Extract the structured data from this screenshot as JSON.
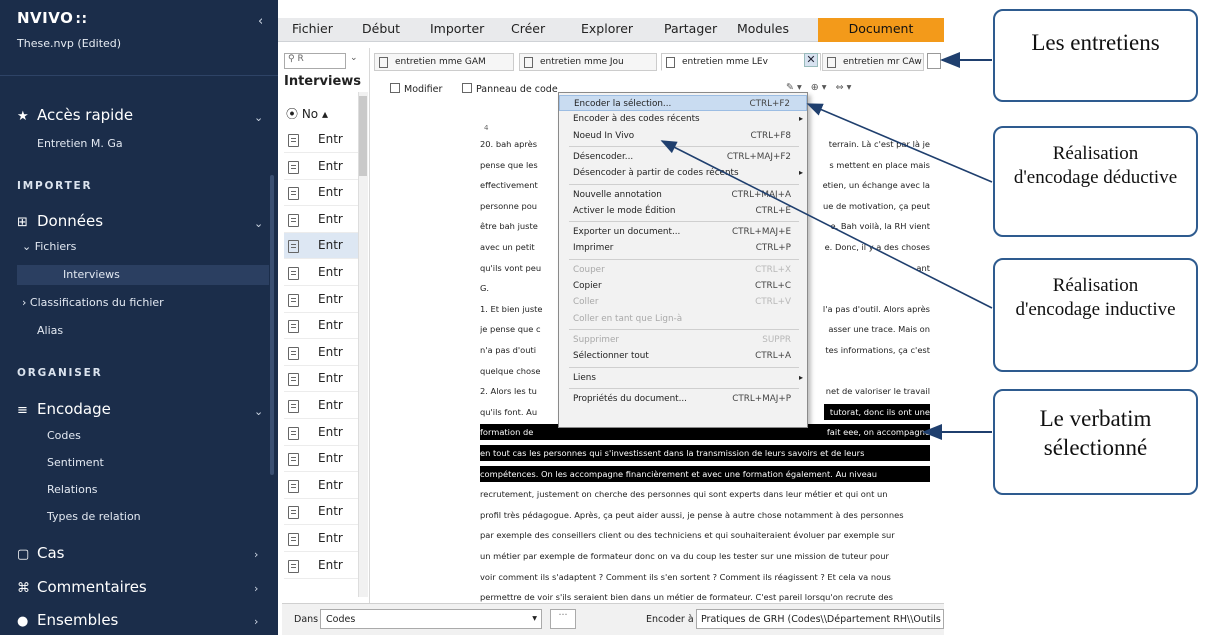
{
  "sidebar": {
    "app_name": "NVIVO",
    "app_dots": "::",
    "project": "These.nvp (Edited)",
    "quick_access": "Accès rapide",
    "quick_item": "Entretien M. Ga",
    "importer": "IMPORTER",
    "donnees": "Données",
    "fichiers": "Fichiers",
    "interviews": "Interviews",
    "classifications": "Classifications du fichier",
    "alias": "Alias",
    "organiser": "ORGANISER",
    "encodage": "Encodage",
    "codes": "Codes",
    "sentiment": "Sentiment",
    "relations": "Relations",
    "types_relation": "Types de relation",
    "cas": "Cas",
    "commentaires": "Commentaires",
    "ensembles": "Ensembles"
  },
  "ribbon": {
    "tabs": [
      "Fichier",
      "Début",
      "Importer",
      "Créer",
      "Explorer",
      "Partager",
      "Modules"
    ],
    "active_tab": "Document"
  },
  "list": {
    "search_placeholder": "R",
    "title": "Interviews",
    "col_header": "No",
    "item_label": "Entr",
    "row_count": 17
  },
  "doc_tabs": [
    "entretien mme GAM",
    "entretien mme Jou",
    "entretien mme LEv",
    "entretien mr CAw"
  ],
  "toolbar": {
    "modifier": "Modifier",
    "panneau": "Panneau de code"
  },
  "context_menu": [
    {
      "label": "Encoder la sélection...",
      "shortcut": "CTRL+F2",
      "state": "hover"
    },
    {
      "label": "Encoder à des codes récents",
      "shortcut": "",
      "submenu": true
    },
    {
      "label": "Noeud In Vivo",
      "shortcut": "CTRL+F8"
    },
    {
      "sep": true
    },
    {
      "label": "Désencoder...",
      "shortcut": "CTRL+MAJ+F2"
    },
    {
      "label": "Désencoder à partir de codes récents",
      "shortcut": "",
      "submenu": true
    },
    {
      "sep": true
    },
    {
      "label": "Nouvelle annotation",
      "shortcut": "CTRL+MAJ+A"
    },
    {
      "label": "Activer le mode Édition",
      "shortcut": "CTRL+E"
    },
    {
      "sep": true
    },
    {
      "label": "Exporter un document...",
      "shortcut": "CTRL+MAJ+E"
    },
    {
      "label": "Imprimer",
      "shortcut": "CTRL+P"
    },
    {
      "sep": true
    },
    {
      "label": "Couper",
      "shortcut": "CTRL+X",
      "disabled": true
    },
    {
      "label": "Copier",
      "shortcut": "CTRL+C"
    },
    {
      "label": "Coller",
      "shortcut": "CTRL+V",
      "disabled": true
    },
    {
      "label": "Coller en tant que Lign-à",
      "shortcut": "",
      "disabled": true
    },
    {
      "sep": true
    },
    {
      "label": "Supprimer",
      "shortcut": "SUPPR",
      "disabled": true
    },
    {
      "label": "Sélectionner tout",
      "shortcut": "CTRL+A"
    },
    {
      "sep": true
    },
    {
      "label": "Liens",
      "shortcut": "",
      "submenu": true
    },
    {
      "sep": true
    },
    {
      "label": "Propriétés du document...",
      "shortcut": "CTRL+MAJ+P"
    }
  ],
  "doc_lines": [
    {
      "l": "20. bah après",
      "r": "terrain. Là c'est par là je"
    },
    {
      "l": "pense que les",
      "r": "s mettent en place mais"
    },
    {
      "l": "effectivement",
      "r": "etien, un échange avec la"
    },
    {
      "l": "personne pou",
      "r": "ue de motivation, ça peut"
    },
    {
      "l": "être bah juste",
      "r": "e. Bah voilà, la RH vient"
    },
    {
      "l": "avec un petit",
      "r": "e. Donc, il y a des choses"
    },
    {
      "l": "qu'ils vont peu",
      "r": "ant"
    },
    {
      "l": "G.",
      "r": ""
    },
    {
      "l": "1. Et bien juste",
      "r": "l'a pas d'outil. Alors après"
    },
    {
      "l": "je pense que c",
      "r": "asser une trace. Mais on"
    },
    {
      "l": "n'a pas d'outi",
      "r": "tes informations, ça c'est"
    },
    {
      "l": "quelque chose",
      "r": ""
    },
    {
      "l": "2. Alors les tu",
      "r": "net de valoriser le travail"
    },
    {
      "l": "qu'ils font. Au",
      "r": "tutorat, donc ils ont une",
      "hl": "partial"
    },
    {
      "l": "formation de",
      "r": "fait eee, on accompagne",
      "hl": "full"
    },
    {
      "full": "en tout cas les personnes qui s'investissent dans la transmission de leurs savoirs et de leurs",
      "hl": "full"
    },
    {
      "full": "compétences. On les accompagne financièrement et avec une formation également. Au niveau",
      "hl": "full"
    },
    {
      "full": "recrutement, justement on cherche des personnes qui sont experts dans leur métier et qui ont un"
    },
    {
      "full": "profil très pédagogue. Après, ça peut aider aussi, je pense à autre chose notamment à des personnes"
    },
    {
      "full": "par exemple des conseillers client ou des techniciens et qui souhaiteraient évoluer par exemple sur"
    },
    {
      "full": "un métier par exemple de formateur donc on va du coup les tester sur une mission de tuteur pour"
    },
    {
      "full": "voir comment ils s'adaptent ? Comment ils s'en sortent ? Comment ils réagissent ? Et cela va nous"
    },
    {
      "full": "permettre de voir s'ils seraient bien dans un métier de formateur. C'est pareil lorsqu'on recrute des"
    }
  ],
  "doc_number": "4",
  "bottom": {
    "dans_label": "Dans",
    "dans_value": "Codes",
    "encoder_label": "Encoder à",
    "encoder_value": "Pratiques de GRH (Codes\\\\Département RH\\\\Outils"
  },
  "annotations": {
    "entretiens": "Les entretiens",
    "deductive": "Réalisation d'encodage déductive",
    "inductive": "Réalisation d'encodage inductive",
    "verbatim": "Le verbatim sélectionné"
  },
  "colors": {
    "sidebar_bg": "#1b2d4a",
    "active_tab": "#f39a1a",
    "annotation_border": "#2e5b8f"
  }
}
